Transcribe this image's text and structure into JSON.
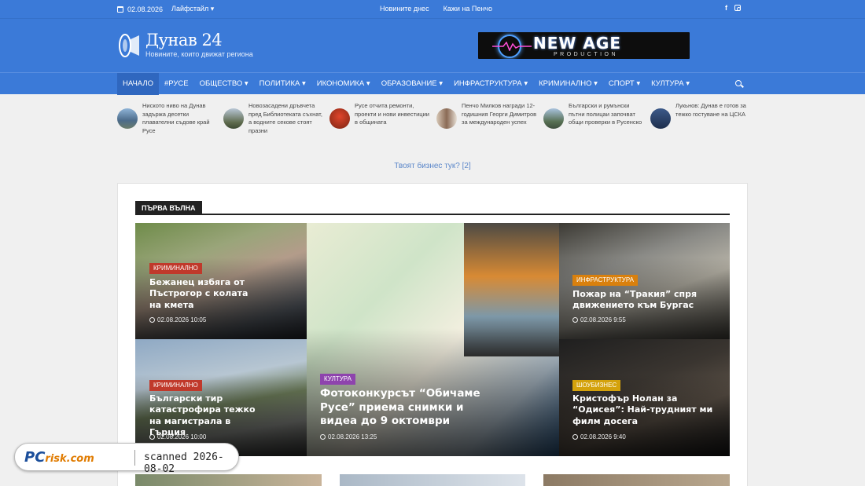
{
  "topbar": {
    "date": "02.08.2026",
    "lifestyle": "Лайфстайл ▾",
    "links": [
      "Новините днес",
      "Кажи на Пенчо"
    ],
    "social": [
      "f",
      "instagram-icon"
    ]
  },
  "header": {
    "title": "Дунав 24",
    "subtitle": "Новините, които движат региона",
    "banner_title": "NEW AGE",
    "banner_sub": "PRODUCTION"
  },
  "nav": {
    "items": [
      "Начало",
      "#Русе",
      "Общество ▾",
      "Политика ▾",
      "Икономика ▾",
      "Образование ▾",
      "Инфраструктура ▾",
      "Криминално ▾",
      "Спорт ▾",
      "Култура ▾"
    ]
  },
  "ticker": [
    {
      "text": "Ниското ниво на Дунав задържа десетки плавателни съдове край Русе"
    },
    {
      "text": "Новозасадени дръвчета пред Библиотеката съхнат, а водните секове стоят празни"
    },
    {
      "text": "Русе отчита ремонти, проекти и нови инвестиции в общината"
    },
    {
      "text": "Пенчо Милков награди 12-годишния Георги Димитров за международен успех"
    },
    {
      "text": "Български и румънски пътни полицаи започват общи проверки в Русенско"
    },
    {
      "text": "Лукьнов: Дунав е готов за тежко гостуване на ЦСКА"
    }
  ],
  "promo": "Твоят бизнес тук? [2]",
  "section": {
    "title": "ПЪРВА ВЪЛНА"
  },
  "tiles": [
    {
      "category": "Криминално",
      "title": "Бежанец избяга от Пъстрогор с колата на кмета",
      "date": "02.08.2026 10:05"
    },
    {
      "category": "Култура",
      "title": "Фотоконкурсът “Обичаме Русе” приема снимки и видеа до 9 октомври",
      "date": "02.08.2026 13:25"
    },
    {
      "category": "Инфраструктура",
      "title": "Пожар на “Тракия” спря движението към Бургас",
      "date": "02.08.2026 9:55"
    },
    {
      "category": "Криминално",
      "title": "Български тир катастрофира тежко на магистрала в Гърция",
      "date": "02.08.2026 10:00"
    },
    {
      "category": "Шоубизнес",
      "title": "Кристофър Нолан за “Одисея”: Най-трудният ми филм досега",
      "date": "02.08.2026 9:40"
    }
  ],
  "watermark": {
    "brand": "PC",
    "brand_suffix": "risk.com",
    "scan": "scanned 2026-08-02"
  }
}
